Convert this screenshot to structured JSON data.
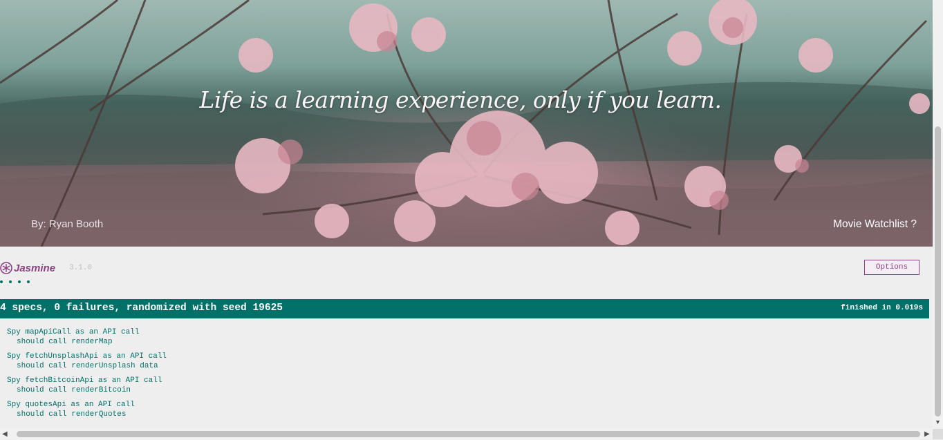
{
  "hero": {
    "quote": "Life is a learning experience, only if you learn.",
    "author": "By: Ryan Booth",
    "watchlist_link": "Movie Watchlist ?"
  },
  "jasmine": {
    "logo_text": "Jasmine",
    "version": "3.1.0",
    "options_label": "Options",
    "spec_dots": 4,
    "summary": "4 specs, 0 failures, randomized with seed 19625",
    "duration": "finished in 0.019s",
    "suites": [
      {
        "title": "Spy mapApiCall as an API call",
        "spec": "should call renderMap"
      },
      {
        "title": "Spy fetchUnsplashApi as an API call",
        "spec": "should call renderUnsplash data"
      },
      {
        "title": "Spy fetchBitcoinApi as an API call",
        "spec": "should call renderBitcoin"
      },
      {
        "title": "Spy quotesApi as an API call",
        "spec": "should call renderQuotes"
      }
    ],
    "colors": {
      "pass": "#007069",
      "brand": "#8a4182"
    }
  }
}
